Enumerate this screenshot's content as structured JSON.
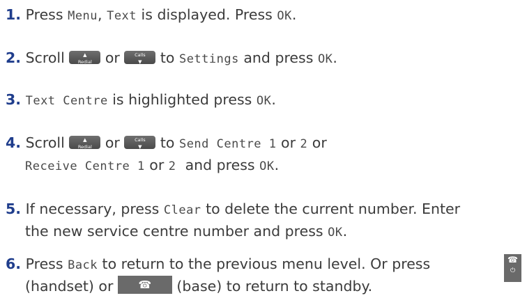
{
  "steps": [
    {
      "n": "1",
      "parts": {
        "a": "Press ",
        "b": "Menu",
        "c": ", ",
        "d": "Text",
        "e": " is displayed. Press ",
        "f": "OK",
        "g": "."
      }
    },
    {
      "n": "2",
      "parts": {
        "a": "Scroll ",
        "b": " or ",
        "c": " to ",
        "d": "Settings",
        "e": " and press ",
        "f": "OK",
        "g": "."
      }
    },
    {
      "n": "3",
      "parts": {
        "a": "Text Centre",
        "b": " is highlighted press ",
        "c": "OK",
        "d": "."
      }
    },
    {
      "n": "4",
      "parts": {
        "a": "Scroll ",
        "b": " or ",
        "c": " to ",
        "d": "Send Centre 1",
        "e": " or ",
        "f": "2",
        "g": " or"
      },
      "line2": {
        "a": "Receive Centre 1",
        "b": " or ",
        "c": "2",
        "d": "  and press ",
        "e": "OK",
        "f": "."
      }
    },
    {
      "n": "5",
      "parts": {
        "a": "If necessary, press ",
        "b": "Clear",
        "c": " to delete the current number. Enter"
      },
      "line2": {
        "a": "the new service centre number and press ",
        "b": "OK",
        "c": "."
      }
    },
    {
      "n": "6",
      "parts": {
        "a": "Press ",
        "b": "Back",
        "c": " to return to the previous menu level. Or press"
      },
      "line2": {
        "a": "(handset) or ",
        "b": " (base) to return to standby."
      }
    }
  ],
  "keys": {
    "redial": {
      "label": "Redial",
      "arrow": "▲"
    },
    "calls": {
      "label": "Calls",
      "arrow": "▼"
    },
    "end_glyph": "☎",
    "power_glyph": "⏻"
  }
}
